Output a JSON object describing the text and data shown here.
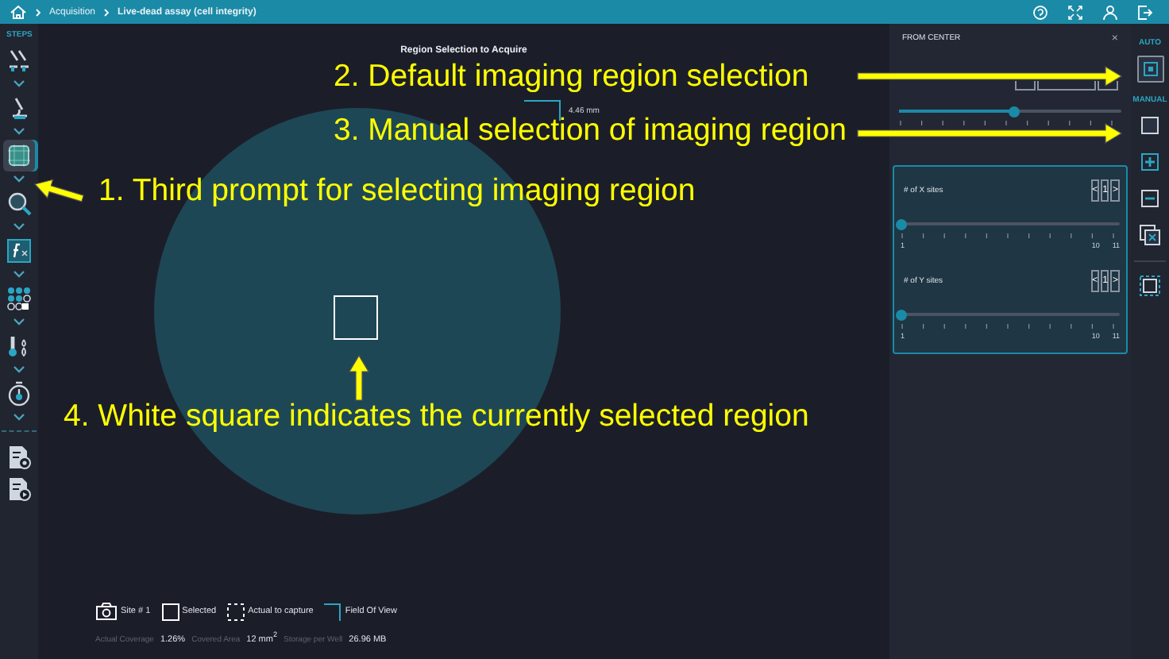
{
  "breadcrumb": [
    {
      "label": "Acquisition",
      "current": false
    },
    {
      "label": "Live-dead assay (cell integrity)",
      "current": true
    }
  ],
  "steps_title": "STEPS",
  "steps": [
    {
      "kind": "dyes",
      "selected": false
    },
    {
      "kind": "microscope",
      "selected": false
    },
    {
      "kind": "region",
      "selected": true
    },
    {
      "kind": "zoom",
      "selected": false
    },
    {
      "kind": "formula",
      "selected": false
    },
    {
      "kind": "wells",
      "selected": false
    },
    {
      "kind": "environment",
      "selected": false
    },
    {
      "kind": "timer",
      "selected": false
    }
  ],
  "reports": [
    {
      "kind": "report-settings",
      "selected": false
    },
    {
      "kind": "report-play",
      "selected": false
    }
  ],
  "canvas": {
    "title": "Region Selection to Acquire",
    "height_label": "4.46 mm",
    "legend": [
      {
        "kind": "site",
        "label": "Site # 1"
      },
      {
        "kind": "selected",
        "label": "Selected"
      },
      {
        "kind": "actual",
        "label": "Actual to capture"
      },
      {
        "kind": "fov",
        "label": "Field Of View"
      }
    ],
    "stats": [
      {
        "label": "Actual Coverage",
        "value": "1.26%"
      },
      {
        "label": "Covered Area",
        "value": "12 mm$^{2}$"
      },
      {
        "label": "Storage per Well",
        "value": "26.96 MB"
      }
    ]
  },
  "panel": {
    "title": "FROM CENTER",
    "close": "×",
    "center_slider": {
      "level": 0.52
    },
    "groups": [
      {
        "label": "# of X sites",
        "prev": "<",
        "value": "1",
        "next": ">",
        "level": 0,
        "min": "1",
        "mid": "10",
        "max": "11"
      },
      {
        "label": "# of Y sites",
        "prev": "<",
        "value": "1",
        "next": ">",
        "level": 0,
        "min": "1",
        "mid": "10",
        "max": "11"
      }
    ]
  },
  "dock": {
    "auto_label": "AUTO",
    "auto_selected": true,
    "manual_label": "MANUAL",
    "tools": [
      {
        "kind": "square",
        "selected": false
      },
      {
        "kind": "plus",
        "selected": false
      },
      {
        "kind": "minus",
        "selected": false
      },
      {
        "kind": "clear",
        "selected": false
      },
      {
        "kind": "dashed",
        "selected": false
      }
    ]
  },
  "annotations": [
    {
      "text": "1. Third prompt for selecting imaging region"
    },
    {
      "text": "2. Default imaging region selection"
    },
    {
      "text": "3. Manual selection of imaging region"
    },
    {
      "text": "4. White square indicates the currently selected region"
    }
  ]
}
